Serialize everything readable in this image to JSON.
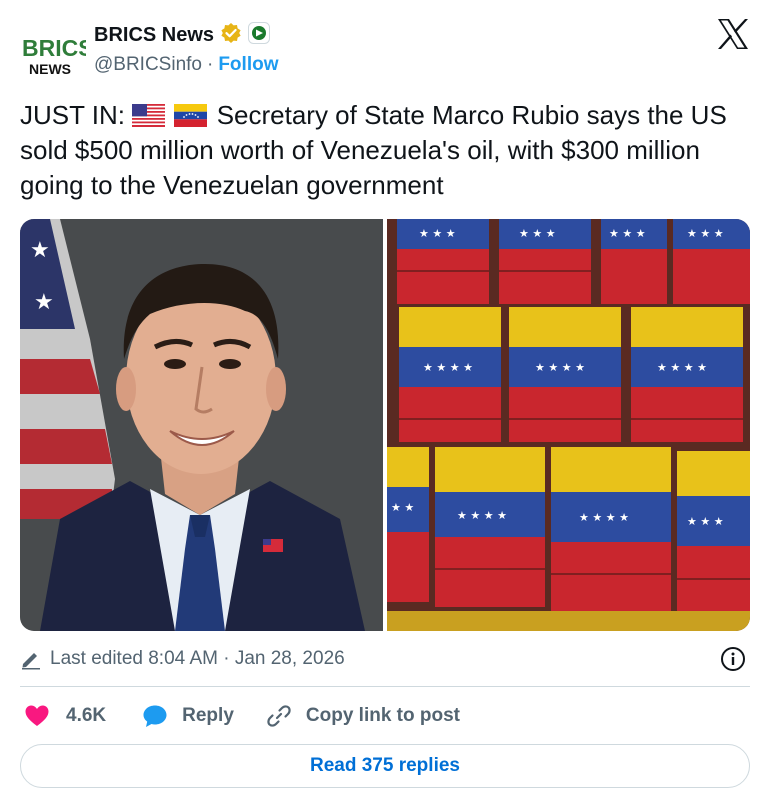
{
  "author": {
    "display_name": "BRICS News",
    "handle": "@BRICSinfo",
    "separator": "·",
    "follow_label": "Follow",
    "logo_text_top": "BRICS",
    "logo_text_bottom": "NEWS"
  },
  "tweet": {
    "text_prefix": "JUST IN:",
    "text_body": "Secretary of State Marco Rubio says the US sold $500 million worth of Venezuela's oil, with $300 million going to the Venezuelan government",
    "flags": [
      "us-flag-icon",
      "venezuela-flag-icon"
    ]
  },
  "media": {
    "images": [
      "portrait-photo",
      "oil-barrels-photo"
    ]
  },
  "meta": {
    "edited_label": "Last edited 8:04 AM · Jan 28, 2026"
  },
  "actions": {
    "like_count": "4.6K",
    "reply_label": "Reply",
    "copy_label": "Copy link to post"
  },
  "footer": {
    "read_replies_label": "Read 375 replies"
  },
  "colors": {
    "accent": "#1d9bf0",
    "like": "#f91880",
    "text": "#0f1419",
    "muted": "#536471",
    "border": "#cfd9de"
  }
}
